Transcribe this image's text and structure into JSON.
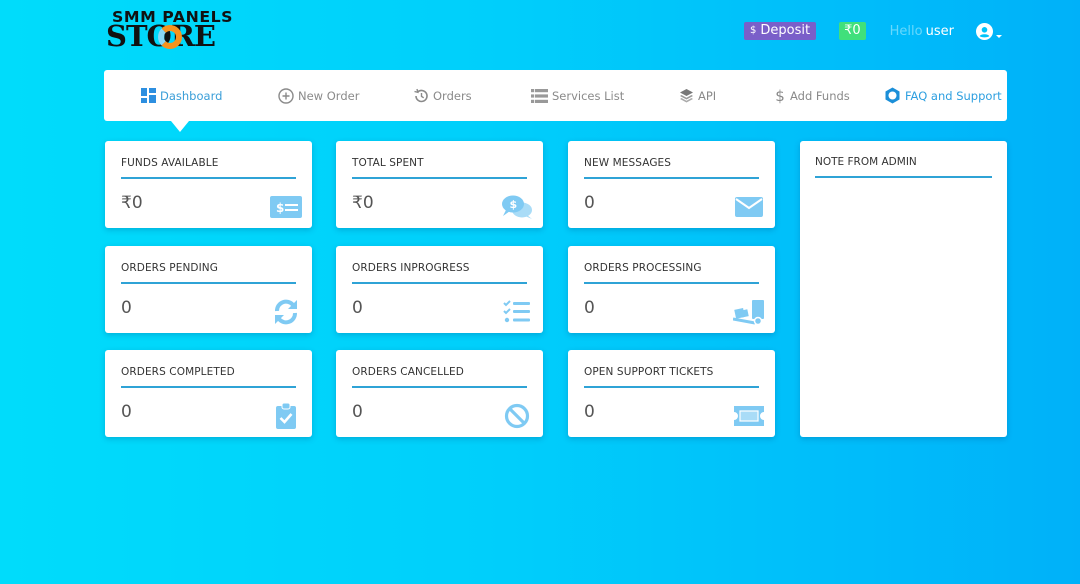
{
  "brand": {
    "line1": "SMM PANELS",
    "line2": "STORE"
  },
  "header": {
    "deposit_icon": "dollar-icon",
    "deposit_label": "Deposit",
    "balance": "₹0",
    "greeting": "Hello",
    "username": "user",
    "user_icon": "user-circle-icon",
    "colors": {
      "deposit": "#7a5fc9",
      "balance": "#40e07b"
    }
  },
  "nav": {
    "items": [
      {
        "label": "Dashboard",
        "icon": "dashboard-icon",
        "active": true
      },
      {
        "label": "New Order",
        "icon": "plus-circle-icon"
      },
      {
        "label": "Orders",
        "icon": "history-icon"
      },
      {
        "label": "Services List",
        "icon": "list-icon"
      },
      {
        "label": "API",
        "icon": "layers-icon"
      },
      {
        "label": "Add Funds",
        "icon": "dollar-icon"
      },
      {
        "label": "FAQ and Support",
        "icon": "gear-icon"
      }
    ]
  },
  "cards": [
    {
      "title": "FUNDS AVAILABLE",
      "value": "₹0",
      "icon": "money-bill-icon"
    },
    {
      "title": "TOTAL SPENT",
      "value": "₹0",
      "icon": "comments-dollar-icon"
    },
    {
      "title": "NEW MESSAGES",
      "value": "0",
      "icon": "envelope-icon"
    },
    {
      "title": "ORDERS PENDING",
      "value": "0",
      "icon": "sync-icon"
    },
    {
      "title": "ORDERS INPROGRESS",
      "value": "0",
      "icon": "tasks-icon"
    },
    {
      "title": "ORDERS PROCESSING",
      "value": "0",
      "icon": "dolly-icon"
    },
    {
      "title": "ORDERS COMPLETED",
      "value": "0",
      "icon": "clipboard-check-icon"
    },
    {
      "title": "ORDERS CANCELLED",
      "value": "0",
      "icon": "ban-icon"
    },
    {
      "title": "OPEN SUPPORT TICKETS",
      "value": "0",
      "icon": "ticket-icon"
    }
  ],
  "note": {
    "title": "NOTE FROM ADMIN"
  },
  "colors": {
    "accent": "#2fa3d6",
    "icon": "#7fcaf3",
    "background_start": "#00dcfb",
    "background_end": "#00b1f9"
  }
}
